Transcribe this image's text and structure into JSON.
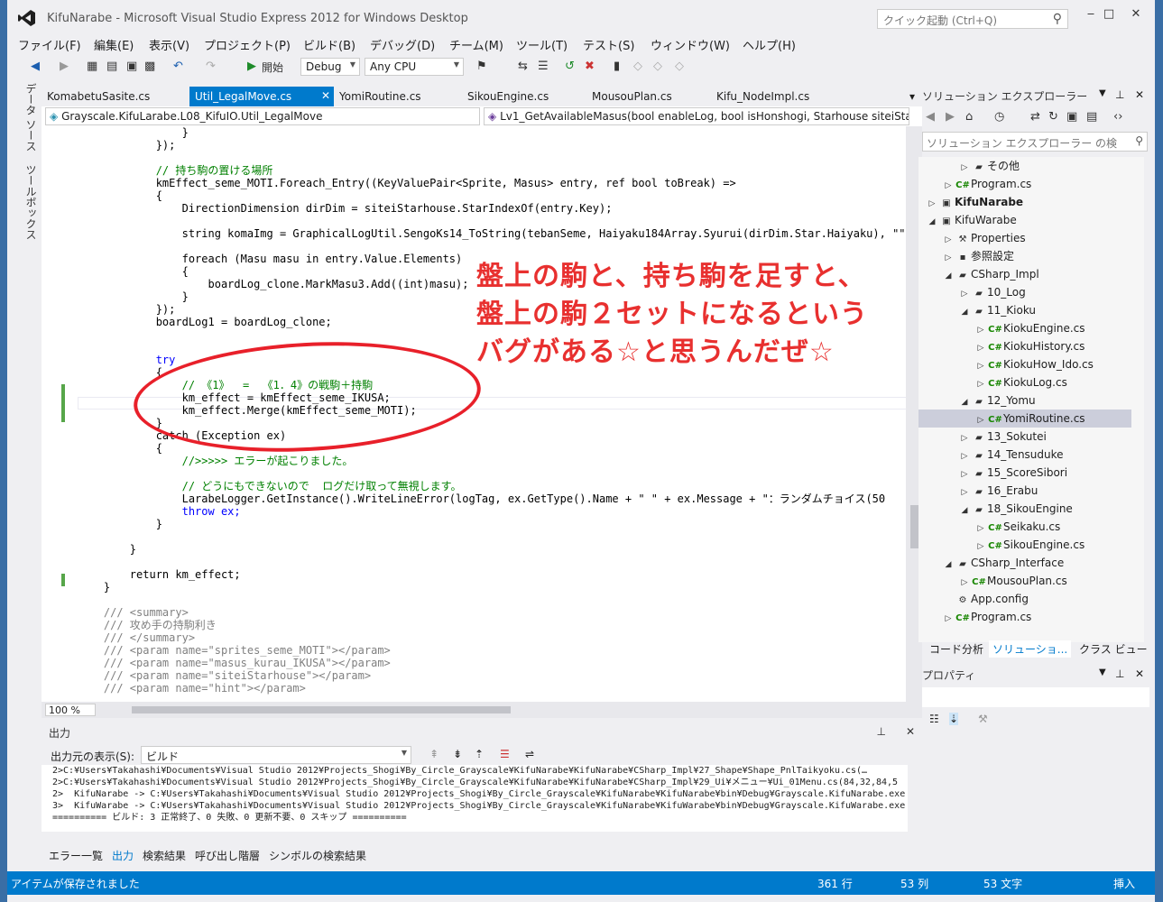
{
  "window": {
    "title": "KifuNarabe - Microsoft Visual Studio Express 2012 for Windows Desktop",
    "quick_launch_placeholder": "クイック起動 (Ctrl+Q)",
    "min": "‒",
    "max": "□",
    "close": "✕"
  },
  "menu": [
    "ファイル(F)",
    "編集(E)",
    "表示(V)",
    "プロジェクト(P)",
    "ビルド(B)",
    "デバッグ(D)",
    "チーム(M)",
    "ツール(T)",
    "テスト(S)",
    "ウィンドウ(W)",
    "ヘルプ(H)"
  ],
  "toolbar": {
    "start_label": "開始",
    "config": "Debug",
    "platform": "Any CPU"
  },
  "left_strip": [
    "データ ソース",
    "ツールボックス"
  ],
  "doc_tabs": [
    "KomabetuSasite.cs",
    "Util_LegalMove.cs",
    "YomiRoutine.cs",
    "SikouEngine.cs",
    "MousouPlan.cs",
    "Kifu_NodeImpl.cs"
  ],
  "navbar": {
    "class": "Grayscale.KifuLarabe.L08_KifuIO.Util_LegalMove",
    "member": "Lv1_GetAvailableMasus(bool enableLog, bool isHonshogi, Starhouse siteiStart"
  },
  "code_lines": [
    [
      "",
      "                }"
    ],
    [
      "",
      "            });"
    ],
    [
      "",
      ""
    ],
    [
      "cm",
      "            // 持ち駒の置ける場所"
    ],
    [
      "",
      "            kmEffect_seme_MOTI.Foreach_Entry((KeyValuePair<Sprite, Masus> entry, ref bool toBreak) =>"
    ],
    [
      "",
      "            {"
    ],
    [
      "",
      "                DirectionDimension dirDim = siteiStarhouse.StarIndexOf(entry.Key);"
    ],
    [
      "",
      ""
    ],
    [
      "",
      "                string komaImg = GraphicalLogUtil.SengoKs14_ToString(tebanSeme, Haiyaku184Array.Syurui(dirDim.Star.Haiyaku), \"\""
    ],
    [
      "",
      ""
    ],
    [
      "",
      "                foreach (Masu masu in entry.Value.Elements)"
    ],
    [
      "",
      "                {"
    ],
    [
      "",
      "                    boardLog_clone.MarkMasu3.Add((int)masu);"
    ],
    [
      "",
      "                }"
    ],
    [
      "",
      "            });"
    ],
    [
      "",
      "            boardLog1 = boardLog_clone;"
    ],
    [
      "",
      ""
    ],
    [
      "",
      ""
    ],
    [
      "kw",
      "            try"
    ],
    [
      "",
      "            {"
    ],
    [
      "cm",
      "                // 《1》  =  《1．4》の戦駒＋持駒"
    ],
    [
      "",
      "                km_effect = kmEffect_seme_IKUSA;"
    ],
    [
      "",
      "                km_effect.Merge(kmEffect_seme_MOTI);"
    ],
    [
      "",
      "            }"
    ],
    [
      "",
      "            catch (Exception ex)"
    ],
    [
      "",
      "            {"
    ],
    [
      "cm",
      "                //>>>>> エラーが起こりました。"
    ],
    [
      "",
      ""
    ],
    [
      "cm",
      "                // どうにもできないので  ログだけ取って無視します。"
    ],
    [
      "",
      "                LarabeLogger.GetInstance().WriteLineError(logTag, ex.GetType().Name + \" \" + ex.Message + \"：ランダムチョイス(50"
    ],
    [
      "kw",
      "                throw ex;"
    ],
    [
      "",
      "            }"
    ],
    [
      "",
      ""
    ],
    [
      "",
      "        }"
    ],
    [
      "",
      ""
    ],
    [
      "",
      "        return km_effect;"
    ],
    [
      "",
      "    }"
    ],
    [
      "",
      ""
    ],
    [
      "xd",
      "    /// <summary>"
    ],
    [
      "xd",
      "    /// 攻め手の持駒利き"
    ],
    [
      "xd",
      "    /// </summary>"
    ],
    [
      "xd",
      "    /// <param name=\"sprites_seme_MOTI\"></param>"
    ],
    [
      "xd",
      "    /// <param name=\"masus_kurau_IKUSA\"></param>"
    ],
    [
      "xd",
      "    /// <param name=\"siteiStarhouse\"></param>"
    ],
    [
      "xd",
      "    /// <param name=\"hint\"></param>"
    ]
  ],
  "annotation": [
    "盤上の駒と、持ち駒を足すと、",
    "盤上の駒２セットになるという",
    "バグがある☆と思うんだぜ☆"
  ],
  "zoom": "100 %",
  "output": {
    "title": "出力",
    "source_label": "出力元の表示(S):",
    "source_value": "ビルド",
    "lines": [
      "2>C:¥Users¥Takahashi¥Documents¥Visual Studio 2012¥Projects_Shogi¥By_Circle_Grayscale¥KifuNarabe¥KifuNarabe¥CSharp_Impl¥27_Shape¥Shape_PnlTaikyoku.cs(…",
      "2>C:¥Users¥Takahashi¥Documents¥Visual Studio 2012¥Projects_Shogi¥By_Circle_Grayscale¥KifuNarabe¥KifuNarabe¥CSharp_Impl¥29_Ui¥メニュー¥Ui_01Menu.cs(84,32,84,5",
      "2>  KifuNarabe -> C:¥Users¥Takahashi¥Documents¥Visual Studio 2012¥Projects_Shogi¥By_Circle_Grayscale¥KifuNarabe¥KifuNarabe¥bin¥Debug¥Grayscale.KifuNarabe.exe",
      "3>  KifuWarabe -> C:¥Users¥Takahashi¥Documents¥Visual Studio 2012¥Projects_Shogi¥By_Circle_Grayscale¥KifuNarabe¥KifuWarabe¥bin¥Debug¥Grayscale.KifuWarabe.exe",
      "========== ビルド: 3 正常終了、0 失敗、0 更新不要、0 スキップ =========="
    ],
    "tabs": [
      "エラー一覧",
      "出力",
      "検索結果",
      "呼び出し階層",
      "シンボルの検索結果"
    ]
  },
  "solution_explorer": {
    "title": "ソリューション エクスプローラー",
    "search_placeholder": "ソリューション エクスプローラー の検",
    "tree": [
      {
        "label": "その他",
        "level": 2,
        "icon": "folder",
        "tw": "right"
      },
      {
        "label": "Program.cs",
        "level": 1,
        "icon": "cs",
        "tw": "right"
      },
      {
        "label": "KifuNarabe",
        "level": 0,
        "icon": "proj",
        "tw": "right",
        "bold": true
      },
      {
        "label": "KifuWarabe",
        "level": 0,
        "icon": "proj",
        "tw": "down"
      },
      {
        "label": "Properties",
        "level": 1,
        "icon": "wrench",
        "tw": "right"
      },
      {
        "label": "参照設定",
        "level": 1,
        "icon": "ref",
        "tw": "right"
      },
      {
        "label": "CSharp_Impl",
        "level": 1,
        "icon": "folder",
        "tw": "down"
      },
      {
        "label": "10_Log",
        "level": 2,
        "icon": "folder",
        "tw": "right"
      },
      {
        "label": "11_Kioku",
        "level": 2,
        "icon": "folder",
        "tw": "down"
      },
      {
        "label": "KiokuEngine.cs",
        "level": 3,
        "icon": "cs",
        "tw": "right"
      },
      {
        "label": "KiokuHistory.cs",
        "level": 3,
        "icon": "cs",
        "tw": "right"
      },
      {
        "label": "KiokuHow_Ido.cs",
        "level": 3,
        "icon": "cs",
        "tw": "right"
      },
      {
        "label": "KiokuLog.cs",
        "level": 3,
        "icon": "cs",
        "tw": "right"
      },
      {
        "label": "12_Yomu",
        "level": 2,
        "icon": "folder",
        "tw": "down"
      },
      {
        "label": "YomiRoutine.cs",
        "level": 3,
        "icon": "cs",
        "tw": "right",
        "selected": true
      },
      {
        "label": "13_Sokutei",
        "level": 2,
        "icon": "folder",
        "tw": "right"
      },
      {
        "label": "14_Tensuduke",
        "level": 2,
        "icon": "folder",
        "tw": "right"
      },
      {
        "label": "15_ScoreSibori",
        "level": 2,
        "icon": "folder",
        "tw": "right"
      },
      {
        "label": "16_Erabu",
        "level": 2,
        "icon": "folder",
        "tw": "right"
      },
      {
        "label": "18_SikouEngine",
        "level": 2,
        "icon": "folder",
        "tw": "down"
      },
      {
        "label": "Seikaku.cs",
        "level": 3,
        "icon": "cs",
        "tw": "right"
      },
      {
        "label": "SikouEngine.cs",
        "level": 3,
        "icon": "cs",
        "tw": "right"
      },
      {
        "label": "CSharp_Interface",
        "level": 1,
        "icon": "folder",
        "tw": "down"
      },
      {
        "label": "MousouPlan.cs",
        "level": 2,
        "icon": "cs",
        "tw": "right"
      },
      {
        "label": "App.config",
        "level": 1,
        "icon": "config",
        "tw": ""
      },
      {
        "label": "Program.cs",
        "level": 1,
        "icon": "cs",
        "tw": "right"
      }
    ],
    "tabs": [
      "コード分析",
      "ソリューショ...",
      "クラス ビュー"
    ]
  },
  "properties": {
    "title": "プロパティ"
  },
  "status": {
    "message": "アイテムが保存されました",
    "line": "361 行",
    "col": "53 列",
    "ch": "53 文字",
    "mode": "挿入"
  }
}
